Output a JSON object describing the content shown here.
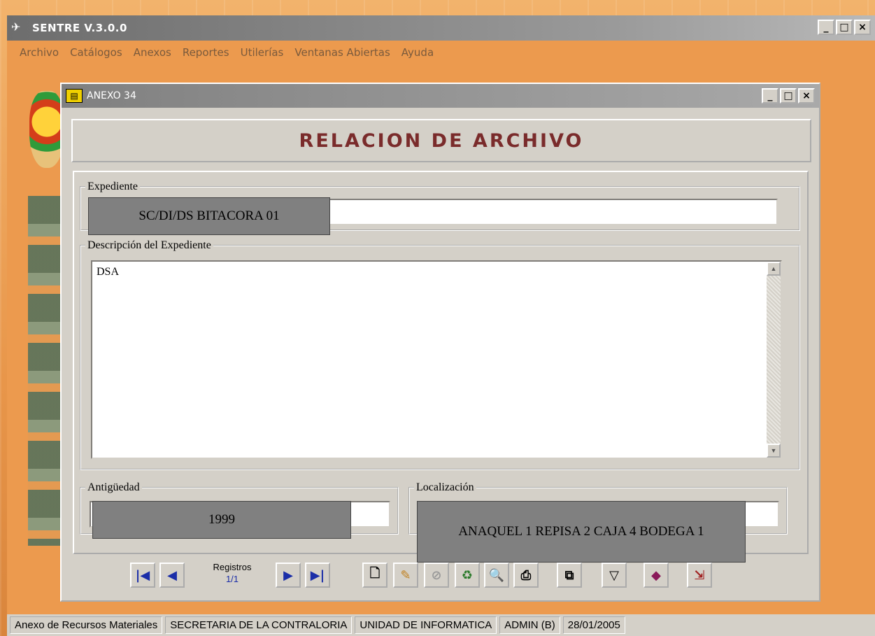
{
  "app": {
    "title": "SENTRE  V.3.0.0",
    "icon": "app-logo-icon"
  },
  "menu": [
    "Archivo",
    "Catálogos",
    "Anexos",
    "Reportes",
    "Utilerías",
    "Ventanas Abiertas",
    "Ayuda"
  ],
  "window_controls": {
    "minimize": "_",
    "maximize": "□",
    "close": "×"
  },
  "child": {
    "title": "ANEXO 34",
    "banner": "RELACION DE ARCHIVO"
  },
  "form": {
    "expediente": {
      "legend": "Expediente",
      "value": "SC/DI/DS BITACORA 01"
    },
    "descripcion": {
      "legend": "Descripción del Expediente",
      "value": "DSA"
    },
    "antiguedad": {
      "legend": "Antigüedad",
      "value": "1999"
    },
    "localizacion": {
      "legend": "Localización",
      "value": "ANAQUEL 1 REPISA 2 CAJA 4 BODEGA 1"
    }
  },
  "navigation": {
    "records_label": "Registros",
    "records_count": "1/1"
  },
  "toolbar_icons": [
    "new-record-icon",
    "edit-icon",
    "cancel-icon",
    "delete-icon",
    "preview-icon",
    "print-icon",
    "copy-icon",
    "filter-icon",
    "help-book-icon",
    "exit-icon"
  ],
  "status_bar": [
    "Anexo de Recursos Materiales",
    "SECRETARIA DE LA CONTRALORIA",
    "UNIDAD DE INFORMATICA",
    "ADMIN (B)",
    "28/01/2005"
  ]
}
